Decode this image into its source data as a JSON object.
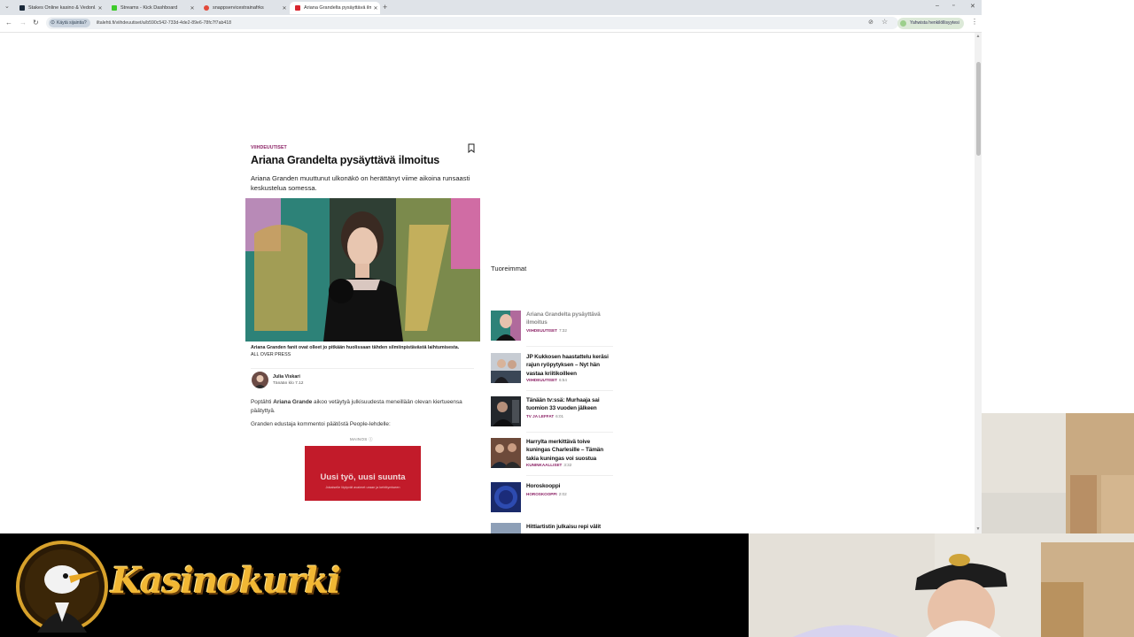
{
  "tabs": [
    {
      "title": "Stakes Online kasino & Vedonl..."
    },
    {
      "title": "Streams - Kick Dashboard"
    },
    {
      "title": "snappservicestrainafrks"
    },
    {
      "title": "Ariana Grandelta pysäyttävä ilm"
    }
  ],
  "toolbar": {
    "vpn_label": "Käytä sijaintia?",
    "url": "iltalehti.fi/viihdeuutiset/a/b590c542-733d-4de2-89e6-78fc7f7ab418",
    "profile_label": "Yahwista henkilöllisyytesi"
  },
  "article": {
    "category": "VIIHDEUUTISET",
    "headline": "Ariana Grandelta pysäyttävä ilmoitus",
    "lead": "Ariana Granden muuttunut ulkonäkö on herättänyt viime aikoina runsaasti keskustelua somessa.",
    "caption": "Ariana Granden fanit ovat olleet jo pitkään huolissaan tähden silmiinpistävästä laihtumisesta.",
    "credit": "ALL OVER PRESS",
    "author_name": "Julia Viskari",
    "author_time": "Tänään klo 7.12",
    "p1_pre": "Poptähti ",
    "p1_bold": "Ariana Grande",
    "p1_post": " aikoo vetäytyä julkisuudesta meneillään olevan kiertueensa päätyttyä.",
    "p2": "Granden edustaja kommentoi päätöstä People-lehdelle:",
    "ad_label": "MAINOS ⓘ",
    "ad_title": "Uusi työ, uusi suunta",
    "ad_sub": "Jokaiselle löytyvät avaimet uraan ja kehittymiseen"
  },
  "sidebar": {
    "title": "Tuoreimmat",
    "items": [
      {
        "headline": "Ariana Grandelta pysäyttävä ilmoitus",
        "category": "VIIHDEUUTISET",
        "time": "7:32"
      },
      {
        "headline": "JP Kukkosen haastattelu keräsi rajun ryöpytyksen – Nyt hän vastaa kriitikoilleen",
        "category": "VIIHDEUUTISET",
        "time": "6:54"
      },
      {
        "headline": "Tänään tv:ssä: Murhaaja sai tuomion 33 vuoden jälkeen",
        "category": "TV JA LEFFAT",
        "time": "6:01"
      },
      {
        "headline": "Harrylta merkittävä toive kuningas Charlesille – Tämän takia kuningas voi suostua",
        "category": "KUNINKAALLISET",
        "time": "3:32"
      },
      {
        "headline": "Horoskooppi",
        "category": "HOROSKOOPPI",
        "time": "2:02"
      },
      {
        "headline": "Hittiartistin julkaisu repi välit",
        "category": "",
        "time": ""
      }
    ]
  },
  "overlay": {
    "logo_text": "Kasinokurki"
  },
  "colors": {
    "accent": "#8c2266",
    "ad_red": "#c21b2a",
    "logo_gold": "#f1b734"
  }
}
